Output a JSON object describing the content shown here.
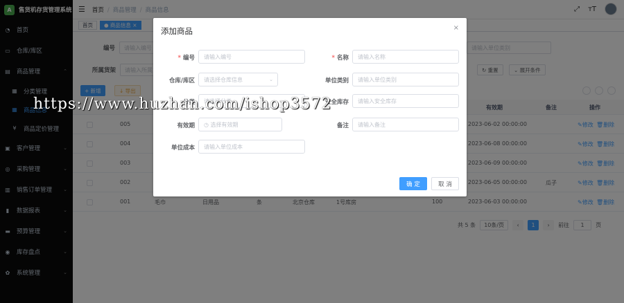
{
  "app": {
    "title": "售货机存货管理系统",
    "logo_text": "A"
  },
  "sidebar": {
    "items": [
      {
        "label": "首页",
        "icon": "dashboard-icon",
        "glyph": "◔"
      },
      {
        "label": "仓库/库区",
        "icon": "warehouse-icon",
        "glyph": "▭"
      },
      {
        "label": "商品管理",
        "icon": "goods-icon",
        "glyph": "▤",
        "expanded": true
      },
      {
        "label": "分类管理",
        "icon": "category-icon",
        "glyph": "▦",
        "sub": true
      },
      {
        "label": "商品信息",
        "icon": "goods-info-icon",
        "glyph": "▦",
        "sub": true,
        "active": true
      },
      {
        "label": "商品定价管理",
        "icon": "price-icon",
        "glyph": "¥",
        "sub": true
      },
      {
        "label": "客户管理",
        "icon": "customer-icon",
        "glyph": "▣"
      },
      {
        "label": "采购管理",
        "icon": "purchase-icon",
        "glyph": "◎"
      },
      {
        "label": "销售订单管理",
        "icon": "sales-order-icon",
        "glyph": "▥"
      },
      {
        "label": "数据报表",
        "icon": "report-icon",
        "glyph": "▮"
      },
      {
        "label": "预算管理",
        "icon": "budget-icon",
        "glyph": "▬"
      },
      {
        "label": "库存盘点",
        "icon": "inventory-icon",
        "glyph": "◉"
      },
      {
        "label": "系统管理",
        "icon": "settings-icon",
        "glyph": "✿"
      }
    ]
  },
  "header": {
    "breadcrumb": [
      "首页",
      "商品管理",
      "商品信息"
    ],
    "icons": {
      "fullscreen": "⤢",
      "font_size": "тT"
    }
  },
  "tags": [
    {
      "label": "首页"
    },
    {
      "label": "● 商品信息 ×",
      "active": true
    }
  ],
  "filters": {
    "code_label": "编号",
    "code_placeholder": "请输入编号",
    "supplier_label": "所属货架",
    "supplier_placeholder": "请输入所属货架",
    "unit_placeholder": "请输入单位类别",
    "reset_label": "↻ 重置",
    "expand_label": "⌄ 展开条件"
  },
  "toolbar": {
    "add_label": "+ 新增",
    "export_label": "↓ 导出"
  },
  "table": {
    "headers": {
      "expiry": "有效期",
      "remark": "备注",
      "actions": "操作"
    },
    "rows": [
      {
        "code": "005",
        "name": "",
        "category": "",
        "unit": "",
        "warehouse": "",
        "area": "",
        "price": "",
        "expiry": "2023-06-02 00:00:00",
        "remark": ""
      },
      {
        "code": "004",
        "name": "",
        "category": "",
        "unit": "",
        "warehouse": "",
        "area": "",
        "price": "",
        "expiry": "2023-06-08 00:00:00",
        "remark": ""
      },
      {
        "code": "003",
        "name": "",
        "category": "",
        "unit": "",
        "warehouse": "",
        "area": "",
        "price": "",
        "expiry": "2023-06-09 00:00:00",
        "remark": ""
      },
      {
        "code": "002",
        "name": "",
        "category": "",
        "unit": "",
        "warehouse": "",
        "area": "",
        "price": "",
        "expiry": "2023-06-05 00:00:00",
        "remark": "瓜子"
      },
      {
        "code": "001",
        "name": "毛巾",
        "category": "日用品",
        "unit": "条",
        "warehouse": "北京仓库",
        "area": "1号库房",
        "price": "100",
        "expiry": "2023-06-03 00:00:00",
        "remark": ""
      }
    ],
    "edit_label": "✎修改",
    "delete_label": "🗑删除"
  },
  "pagination": {
    "total": "共 5 条",
    "page_size": "10条/页",
    "prev": "‹",
    "current": "1",
    "next": "›",
    "goto_label": "前往",
    "goto_value": "1",
    "page_unit": "页"
  },
  "modal": {
    "title": "添加商品",
    "close": "×",
    "fields": {
      "code_label": "编号",
      "code_placeholder": "请输入编号",
      "name_label": "名称",
      "name_placeholder": "请输入名称",
      "warehouse_label": "仓库/库区",
      "warehouse_placeholder": "请选择仓库信息",
      "unit_label": "单位类别",
      "unit_placeholder": "请输入单位类别",
      "category_label": "分类",
      "category_placeholder": "请选择分类",
      "safety_stock_label": "安全库存",
      "safety_stock_placeholder": "请输入安全库存",
      "expiry_label": "有效期",
      "expiry_placeholder": "◷ 选择有效期",
      "remark_label": "备注",
      "remark_placeholder": "请输入备注",
      "cost_label": "单位成本",
      "cost_placeholder": "请输入单位成本"
    },
    "ok_label": "确 定",
    "cancel_label": "取 消"
  },
  "watermark": "https://www.huzhan.com/ishop3572"
}
